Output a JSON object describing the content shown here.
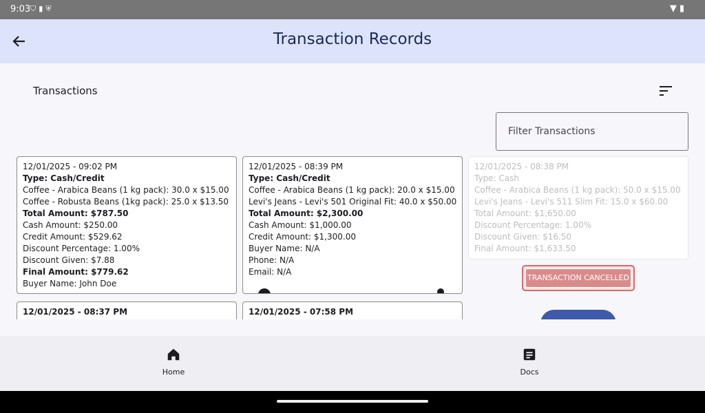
{
  "status_bar": {
    "time": "9:03",
    "left_icons": [
      "shield-icon",
      "sim-icon",
      "vpn-icon"
    ],
    "right_icons": [
      "wifi-icon",
      "battery-icon"
    ]
  },
  "app_bar": {
    "title": "Transaction Records",
    "back_icon": "arrow-back-icon"
  },
  "section": {
    "title": "Transactions",
    "sort_icon": "sort-icon"
  },
  "filter": {
    "placeholder": "Filter Transactions"
  },
  "transactions": [
    {
      "datetime": "12/01/2025 - 09:02 PM",
      "type": "Type: Cash/Credit",
      "items": [
        "Coffee - Arabica Beans (1 kg pack): 30.0 x $15.00",
        "Coffee - Robusta Beans (1kg pack): 25.0 x $13.50"
      ],
      "total": "Total Amount: $787.50",
      "cash": "Cash Amount: $250.00",
      "credit": "Credit Amount: $529.62",
      "discount_pct": "Discount Percentage: 1.00%",
      "discount_given": "Discount Given: $7.88",
      "final": "Final Amount: $779.62",
      "buyer": "Buyer Name: John Doe"
    },
    {
      "datetime": "12/01/2025 - 08:39 PM",
      "type": "Type: Cash/Credit",
      "items": [
        "Coffee - Arabica Beans (1 kg pack): 20.0 x $15.00",
        "Levi's Jeans - Levi's 501 Original Fit: 40.0 x $50.00"
      ],
      "total": "Total Amount: $2,300.00",
      "cash": "Cash Amount: $1,000.00",
      "credit": "Credit Amount: $1,300.00",
      "buyer": "Buyer Name: N/A",
      "phone": "Phone: N/A",
      "email": "Email: N/A"
    },
    {
      "datetime": "12/01/2025 - 08:38 PM",
      "type": "Type: Cash",
      "items": [
        "Coffee - Arabica Beans (1 kg pack): 50.0 x $15.00",
        "Levi's Jeans - Levi's 511 Slim Fit: 15.0 x $60.00"
      ],
      "total": "Total Amount: $1,650.00",
      "discount_pct": "Discount Percentage: 1.00%",
      "discount_given": "Discount Given: $16.50",
      "final": "Final Amount: $1,633.50",
      "status_label": "TRANSACTION CANCELLED"
    },
    {
      "datetime": "12/01/2025 - 08:37 PM"
    },
    {
      "datetime": "12/01/2025 - 07:58 PM"
    }
  ],
  "bottom_nav": [
    {
      "label": "Home",
      "icon": "home-icon"
    },
    {
      "label": "Docs",
      "icon": "document-icon"
    }
  ],
  "colors": {
    "app_bar_bg": "#dce3fb",
    "title": "#1b2a55",
    "cancel_bg": "#d98b8b",
    "cancel_border": "#d16c6c",
    "primary_button": "#3e5aa8"
  }
}
